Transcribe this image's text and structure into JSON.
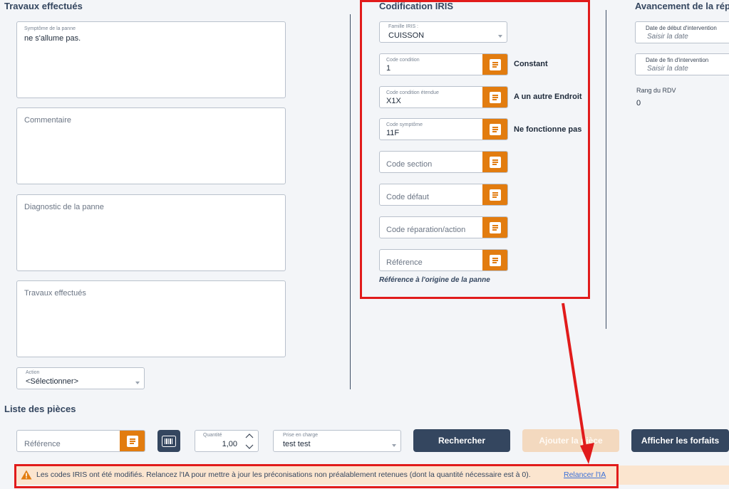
{
  "travaux": {
    "title": "Travaux effectués",
    "symptome_label": "Symptôme de la panne",
    "symptome_value": "ne s'allume pas.",
    "commentaire_ph": "Commentaire",
    "diagnostic_ph": "Diagnostic de la panne",
    "travaux_ph": "Travaux effectués",
    "action_label": "Action",
    "action_value": "<Sélectionner>"
  },
  "iris": {
    "title": "Codification IRIS",
    "famille_label": "Famille IRIS :",
    "famille_value": "CUISSON",
    "code_condition_label": "Code condition",
    "code_condition_value": "1",
    "code_condition_desc": "Constant",
    "code_cond_etendue_label": "Code condition étendue",
    "code_cond_etendue_value": "X1X",
    "code_cond_etendue_desc": "A un autre Endroit",
    "code_symptome_label": "Code symptôme",
    "code_symptome_value": "11F",
    "code_symptome_desc": "Ne fonctionne pas",
    "code_section_ph": "Code section",
    "code_defaut_ph": "Code défaut",
    "code_reparation_ph": "Code réparation/action",
    "reference_ph": "Référence",
    "reference_origine": "Référence à l'origine de la panne"
  },
  "avancement": {
    "title": "Avancement de la répa",
    "date_debut_label": "Date de début d'intervention",
    "date_debut_ph": "Saisir la date",
    "date_fin_label": "Date de fin d'intervention",
    "date_fin_ph": "Saisir la date",
    "rang_label": "Rang du RDV",
    "rang_value": "0"
  },
  "pieces": {
    "title": "Liste des pièces",
    "reference_ph": "Référence",
    "quantite_label": "Quantité",
    "quantite_value": "1,00",
    "prise_label": "Prise en charge",
    "prise_value": "test test",
    "rechercher": "Rechercher",
    "ajouter_piece": "Ajouter la pièce",
    "afficher_forfaits": "Afficher les forfaits"
  },
  "alert": {
    "message": "Les codes IRIS ont été modifiés. Relancez l'IA pour mettre à jour les préconisations non préalablement retenues (dont la quantité nécessaire est à 0).",
    "link": "Relancer l'IA"
  },
  "colors": {
    "accent_orange": "#e27c0f",
    "navy_button": "#34465f",
    "disabled_button": "#f3d9bf",
    "annotation_red": "#e11b1b",
    "alert_bg": "#fbe5cf"
  },
  "icons": [
    "notepad-icon",
    "barcode-icon",
    "chevron-up-icon",
    "chevron-down-icon",
    "warning-icon",
    "dropdown-caret-icon"
  ]
}
